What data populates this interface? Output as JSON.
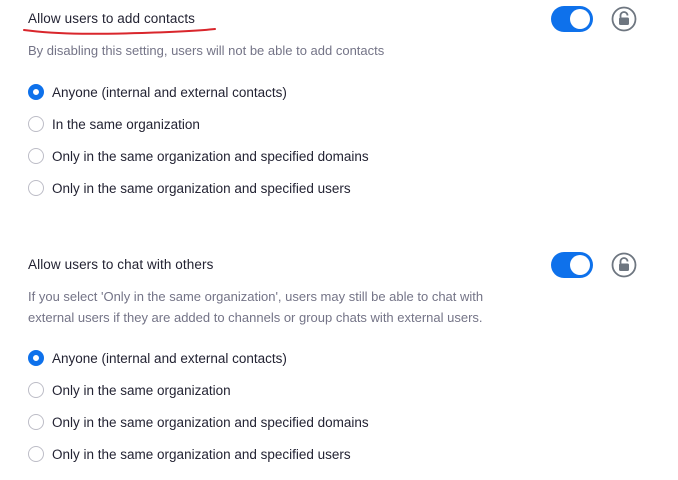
{
  "settings": [
    {
      "title": "Allow users to add contacts",
      "description": "By disabling this setting, users will not be able to add contacts",
      "enabled": true,
      "options": [
        {
          "label": "Anyone (internal and external contacts)",
          "selected": true
        },
        {
          "label": "In the same organization",
          "selected": false
        },
        {
          "label": "Only in the same organization and specified domains",
          "selected": false
        },
        {
          "label": "Only in the same organization and specified users",
          "selected": false
        }
      ]
    },
    {
      "title": "Allow users to chat with others",
      "description": "If you select 'Only in the same organization', users may still be able to chat with external users if they are added to channels or group chats with external users.",
      "enabled": true,
      "options": [
        {
          "label": "Anyone (internal and external contacts)",
          "selected": true
        },
        {
          "label": "Only in the same organization",
          "selected": false
        },
        {
          "label": "Only in the same organization and specified domains",
          "selected": false
        },
        {
          "label": "Only in the same organization and specified users",
          "selected": false
        }
      ]
    }
  ],
  "colors": {
    "accent": "#0e71eb",
    "annotation": "#d9262c",
    "text": "#232333",
    "muted": "#747487"
  },
  "icons": {
    "toggle": "toggle-switch-icon",
    "lock": "unlocked-padlock-icon",
    "annotation": "red-underline-annotation"
  }
}
